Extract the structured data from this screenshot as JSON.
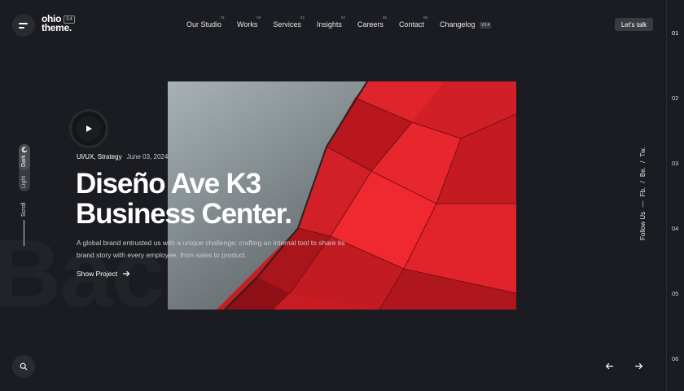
{
  "brand": {
    "line1": "ohio",
    "line2": "theme.",
    "version": "3.4"
  },
  "nav": [
    {
      "label": "Our Studio",
      "num": "01"
    },
    {
      "label": "Works",
      "num": "02"
    },
    {
      "label": "Services",
      "num": "03"
    },
    {
      "label": "Insights",
      "num": "04"
    },
    {
      "label": "Careers",
      "num": "05"
    },
    {
      "label": "Contact",
      "num": "06"
    },
    {
      "label": "Changelog",
      "num": "",
      "badge": "V3.4"
    }
  ],
  "cta": {
    "label": "Let's talk"
  },
  "slides": [
    "01",
    "02",
    "03",
    "04",
    "05",
    "06"
  ],
  "project": {
    "category": "UI/UX, Strategy",
    "date": "June 03, 2024",
    "title_line1": "Diseño Ave K3",
    "title_line2": "Business Center.",
    "description": "A global brand entrusted us with a unique challenge: crafting an internal tool to share its brand story with every employee, from sales to product.",
    "link_label": "Show Project"
  },
  "theme": {
    "dark_label": "Dark",
    "light_label": "Light"
  },
  "scroll_label": "Scroll",
  "social": {
    "label": "Follow Us",
    "items": [
      "Fb.",
      "Be.",
      "Tw."
    ]
  },
  "watermark": "Bac  Diseñ",
  "icons": {
    "menu": "hamburger-icon",
    "play": "play-icon",
    "search": "search-icon",
    "prev": "arrow-left-icon",
    "next": "arrow-right-icon",
    "show": "arrow-right-icon",
    "theme": "moon-icon"
  },
  "colors": {
    "background": "#1b1c21",
    "accent_red": "#e2242c",
    "button": "#3a3b41"
  }
}
